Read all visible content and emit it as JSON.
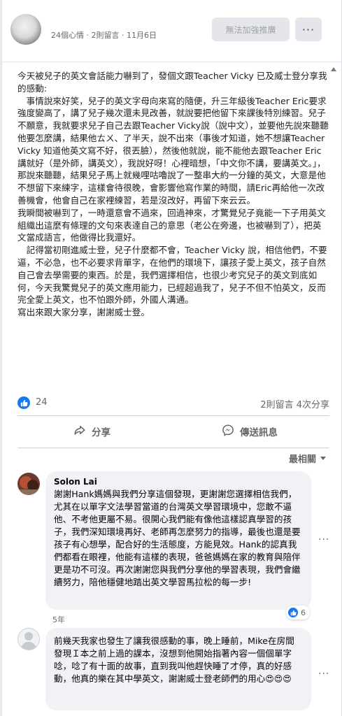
{
  "header": {
    "meta": "24個心情 · 2則留言 · 11月6日",
    "disabled_button": "無法加強推廣",
    "more_button": "···"
  },
  "post": {
    "paragraphs": [
      "今天被兒子的英文會話能力嚇到了，發個文跟Teacher Vicky 已及威士登分享我的感動:",
      "　事情說來好笑，兒子的英文字母向來寫的隨便，升三年級後Teacher Eric要求強度變高了，講了兒子幾次還未見改善，就說要把他留下來課後特別練習。兒子不願意，我就要求兒子自己去跟Teacher Vicky說（說中文），並要他先說來聽聽他要怎麼講，結果他ㄊㄨ、了半天，說不出來（事後才知道，她不想讓Teacher Vicky 知道他英文寫不好，很丟臉），然後他就說，能不能他去跟Teacher Eric講就好（是外師，講英文），我說好呀！心裡暗想，「中文你不講，要講英文。」，那說來聽聽，結果兒子馬上就幾哩咕嚕說了一整串大約一分鐘的英文，大意是他不想留下來練字，這樣會待很晚，會影響他寫作業的時間，請Eric再給他一次改善機會，他會自己在家裡練習，若是沒改好，再留下來云云。",
      "我瞬間被嚇到了，一時還意會不過來，回過神來，才驚覺兒子竟能一下子用英文組織出這麼有條理的文句來表達自己的意思（老公在旁邊，也被嚇到了），把英文當成語言，他做得比我還好。",
      "　記得當初剛進威士登，兒子什麼都不會，Teacher Vicky 說，相信他們，不要逼，不必急，也不必要求背單字，在他們的環境下，讓孩子愛上英文，孩子自然自己會去學需要的東西。於是，我們選擇相信，也很少考究兒子的英文到底如何，今天我驚覺兒子的英文應用能力，已經超過我了，兒子不但不怕英文，反而完全愛上英文，也不怕跟外師，外國人溝通。",
      "寫出來跟大家分享，謝謝威士登。"
    ]
  },
  "reactions": {
    "like_count": "24",
    "stats": "2則留言  4次分享"
  },
  "actions": {
    "share": "分享",
    "message": "傳送訊息"
  },
  "sort": {
    "label": "最相關"
  },
  "comments": [
    {
      "name": "Solon Lai",
      "text": "謝謝Hank媽媽與我們分享這個發現，更謝謝您選擇相信我們，尤其在以單字文法學習當道的台灣英文學習環境中，您敢不逼他、不考他更屬不易。很開心我們能有像他這樣認真學習的孩子，我們深知環境再好、老師再怎麼努力的指導，最後也還是要孩子有心想學，配合好的生活態度，方能見效。Hank的認真我們都看在眼裡，他能有這樣的表現，爸爸媽媽在家的教育與陪伴更是功不可沒。再次謝謝您與我們分享他的學習表現，我們會繼續努力，陪他穩健地踏出英文學習馬拉松的每一步!",
      "time": "5年",
      "reactions": "6"
    },
    {
      "name": "",
      "text": "前幾天我家也發生了讓我很感動的事，晚上睡前，Mike在房間發現Ｉ本之前上過的課本，沒想到他開始指著內容一個個單字唸，唸了有十面的故事，直到我叫他趕快睡了才停，真的好感動，他真的樂在其中學英文，謝謝威士登老師們的用心",
      "emojis": "😍😍😍"
    }
  ],
  "colors": {
    "accent": "#1877f2",
    "muted": "#65676b",
    "bubble": "#f0f2f5"
  }
}
